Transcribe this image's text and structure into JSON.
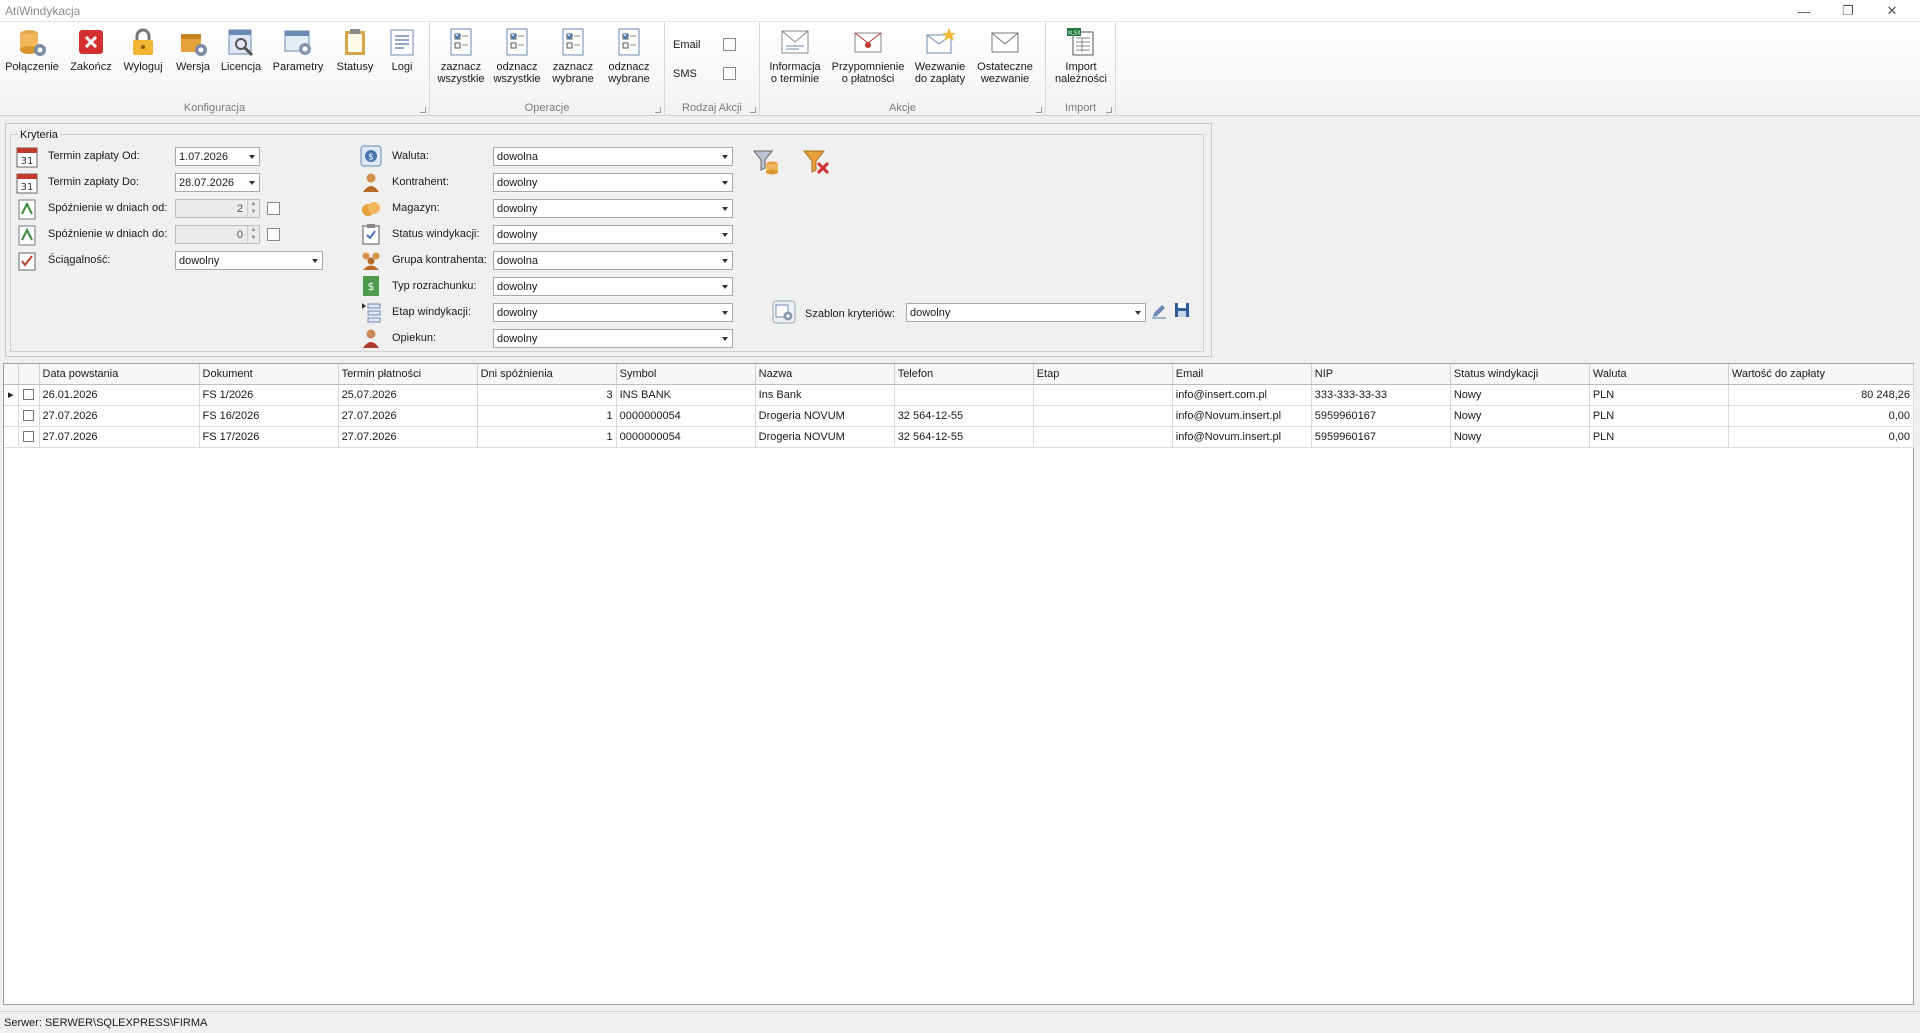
{
  "window": {
    "title": "AtiWindykacja"
  },
  "ribbon": {
    "groups": [
      {
        "caption": "Konfiguracja",
        "buttons": [
          "Połączenie",
          "Zakończ",
          "Wyloguj",
          "Wersja",
          "Licencja",
          "Parametry",
          "Statusy",
          "Logi"
        ]
      },
      {
        "caption": "Operacje",
        "buttons": [
          [
            "zaznacz",
            "wszystkie"
          ],
          [
            "odznacz",
            "wszystkie"
          ],
          [
            "zaznacz",
            "wybrane"
          ],
          [
            "odznacz",
            "wybrane"
          ]
        ]
      },
      {
        "caption": "Rodzaj Akcji",
        "checks": [
          "Email",
          "SMS"
        ]
      },
      {
        "caption": "Akcje",
        "buttons": [
          [
            "Informacja",
            "o terminie"
          ],
          [
            "Przypomnienie",
            "o płatności"
          ],
          [
            "Wezwanie",
            "do zapłaty"
          ],
          [
            "Ostateczne",
            "wezwanie"
          ]
        ]
      },
      {
        "caption": "Import",
        "buttons": [
          [
            "Import",
            "należności"
          ]
        ]
      }
    ]
  },
  "criteria": {
    "legend": "Kryteria",
    "left": [
      {
        "label": "Termin zapłaty Od:",
        "value": "1.07.2026"
      },
      {
        "label": "Termin zapłaty  Do:",
        "value": "28.07.2026"
      },
      {
        "label": "Spóźnienie w dniach od:",
        "value": "2"
      },
      {
        "label": "Spóźnienie w dniach do:",
        "value": "0"
      },
      {
        "label": "Ściągalność:",
        "value": "dowolny"
      }
    ],
    "middle": [
      {
        "label": "Waluta:",
        "value": "dowolna"
      },
      {
        "label": "Kontrahent:",
        "value": "dowolny"
      },
      {
        "label": "Magazyn:",
        "value": "dowolny"
      },
      {
        "label": "Status windykacji:",
        "value": "dowolny"
      },
      {
        "label": "Grupa kontrahenta:",
        "value": "dowolna"
      },
      {
        "label": "Typ rozrachunku:",
        "value": "dowolny"
      },
      {
        "label": "Etap windykacji:",
        "value": "dowolny"
      },
      {
        "label": "Opiekun:",
        "value": "dowolny"
      }
    ],
    "template": {
      "label": "Szablon kryteriów:",
      "value": "dowolny"
    }
  },
  "grid": {
    "columns": [
      "Data powstania",
      "Dokument",
      "Termin płatności",
      "Dni spóźnienia",
      "Symbol",
      "Nazwa",
      "Telefon",
      "Etap",
      "Email",
      "NIP",
      "Status windykacji",
      "Waluta",
      "Wartość do zapłaty"
    ],
    "rows": [
      [
        "26.01.2026",
        "FS 1/2026",
        "25.07.2026",
        "3",
        "INS BANK",
        "Ins Bank",
        "",
        "",
        "info@insert.com.pl",
        "333-333-33-33",
        "Nowy",
        "PLN",
        "80 248,26"
      ],
      [
        "27.07.2026",
        "FS 16/2026",
        "27.07.2026",
        "1",
        "0000000054",
        "Drogeria NOVUM",
        "32 564-12-55",
        "",
        "info@Novum.insert.pl",
        "5959960167",
        "Nowy",
        "PLN",
        "0,00"
      ],
      [
        "27.07.2026",
        "FS 17/2026",
        "27.07.2026",
        "1",
        "0000000054",
        "Drogeria NOVUM",
        "32 564-12-55",
        "",
        "info@Novum.insert.pl",
        "5959960167",
        "Nowy",
        "PLN",
        "0,00"
      ]
    ]
  },
  "status": {
    "server": "Serwer: SERWER\\SQLEXPRESS\\FIRMA"
  }
}
